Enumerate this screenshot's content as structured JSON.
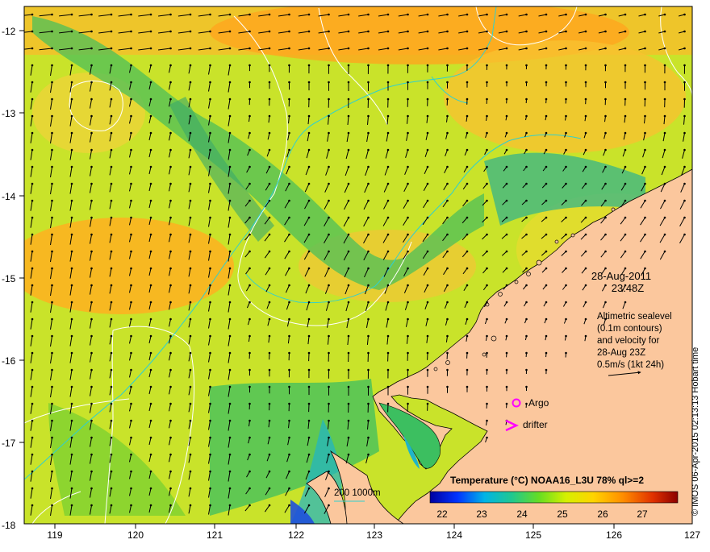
{
  "map": {
    "date": "28-Aug-2011",
    "time": "23:48Z",
    "legend_lines": [
      "Altimetric sealevel",
      "(0.1m contours)",
      "and velocity for",
      "28-Aug 23Z",
      "0.5m/s (1kt 24h)"
    ],
    "markers": {
      "argo": "Argo",
      "drifter": "drifter"
    },
    "isobath_label": "200  1000m",
    "colorbar": {
      "title": "Temperature (°C) NOAA16_L3U 78% ql>=2",
      "ticks": [
        "22",
        "23",
        "24",
        "25",
        "26",
        "27"
      ],
      "colors": [
        "#0000a0",
        "#0033ff",
        "#00b4e6",
        "#20c890",
        "#66dd22",
        "#d6f000",
        "#ffd400",
        "#ff8c00",
        "#e03000",
        "#8b0000"
      ]
    },
    "credit": "© IMOS 06-Apr-2015 02:13:13 Hobart time",
    "x_ticks": [
      "119",
      "120",
      "121",
      "122",
      "123",
      "124",
      "125",
      "126",
      "127"
    ],
    "y_ticks": [
      "-12",
      "-13",
      "-14",
      "-15",
      "-16",
      "-17",
      "-18"
    ],
    "colors": {
      "land": "#fbc79d",
      "warm": "#ff9f1c",
      "cool": "#3cb878",
      "mid": "#c9e32a",
      "contour": "#ffffff",
      "isobath": "#2fd0d0",
      "marker": "#ff00ff"
    }
  }
}
